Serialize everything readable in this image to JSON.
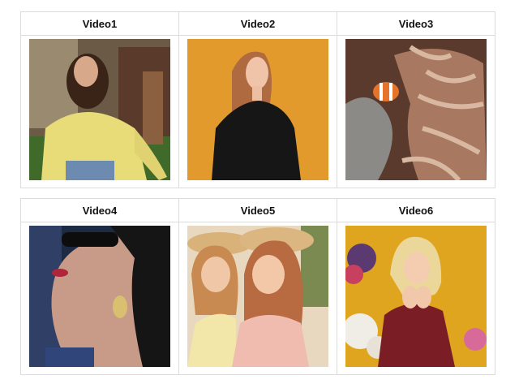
{
  "videos_top": [
    {
      "title": "Video1",
      "thumbnail": "woman-yellow-blouse-outdoors"
    },
    {
      "title": "Video2",
      "thumbnail": "woman-black-shirt-orange-backdrop"
    },
    {
      "title": "Video3",
      "thumbnail": "clownfish-sea-anemone"
    }
  ],
  "videos_bottom": [
    {
      "title": "Video4",
      "thumbnail": "woman-sunglasses-earring-closeup"
    },
    {
      "title": "Video5",
      "thumbnail": "two-women-straw-hats-laughing"
    },
    {
      "title": "Video6",
      "thumbnail": "blonde-woman-flowers-yellow-backdrop"
    }
  ]
}
